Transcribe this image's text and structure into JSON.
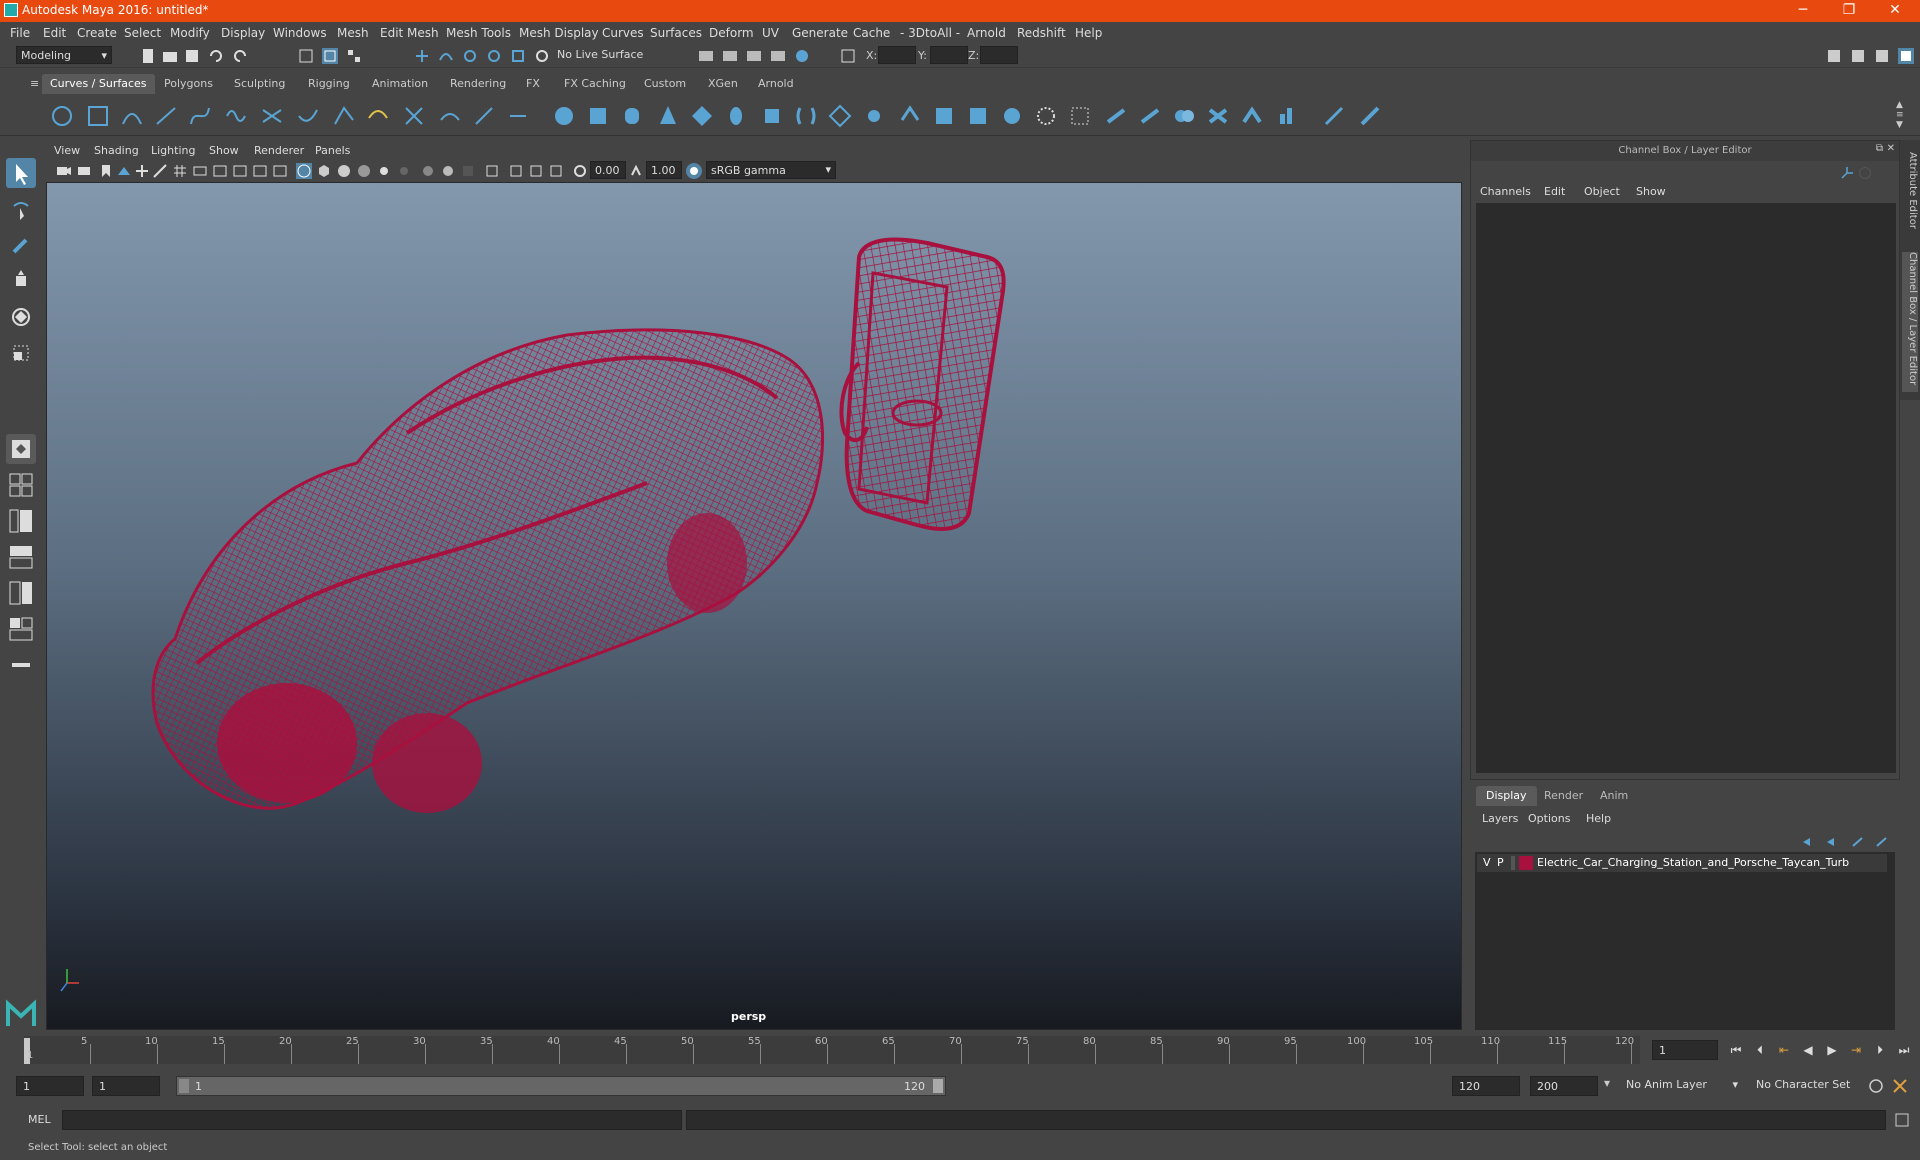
{
  "titlebar": {
    "title": "Autodesk Maya 2016: untitled*",
    "minimize": "─",
    "restore": "❐",
    "close": "✕"
  },
  "menubar": [
    "File",
    "Edit",
    "Create",
    "Select",
    "Modify",
    "Display",
    "Windows",
    "Mesh",
    "Edit Mesh",
    "Mesh Tools",
    "Mesh Display",
    "Curves",
    "Surfaces",
    "Deform",
    "UV",
    "Generate",
    "Cache",
    "- 3DtoAll -",
    "Arnold",
    "Redshift",
    "Help"
  ],
  "statusline": {
    "mode": "Modeling",
    "live_surface": "No Live Surface",
    "x_label": "X:",
    "y_label": "Y:",
    "z_label": "Z:"
  },
  "shelf_tabs": [
    "Curves / Surfaces",
    "Polygons",
    "Sculpting",
    "Rigging",
    "Animation",
    "Rendering",
    "FX",
    "FX Caching",
    "Custom",
    "XGen",
    "Arnold"
  ],
  "shelf_active": "Curves / Surfaces",
  "viewport": {
    "menu": [
      "View",
      "Shading",
      "Lighting",
      "Show",
      "Renderer",
      "Panels"
    ],
    "exposure": "0.00",
    "gamma": "1.00",
    "color_space": "sRGB gamma",
    "camera": "persp",
    "wire_color": "#a8103e"
  },
  "channel_box": {
    "header": "Channel Box / Layer Editor",
    "menu": [
      "Channels",
      "Edit",
      "Object",
      "Show"
    ]
  },
  "layer_editor": {
    "tabs": [
      "Display",
      "Render",
      "Anim"
    ],
    "active_tab": "Display",
    "menu": [
      "Layers",
      "Options",
      "Help"
    ],
    "layers": [
      {
        "v": "V",
        "p": "P",
        "color": "#a8103e",
        "name": "Electric_Car_Charging_Station_and_Porsche_Taycan_Turb"
      }
    ]
  },
  "side_tabs": [
    "Attribute Editor",
    "Channel Box / Layer Editor"
  ],
  "timeslider": {
    "labels": [
      "1",
      "5",
      "10",
      "15",
      "20",
      "25",
      "30",
      "35",
      "40",
      "45",
      "50",
      "55",
      "60",
      "65",
      "70",
      "75",
      "80",
      "85",
      "90",
      "95",
      "100",
      "105",
      "110",
      "115",
      "120"
    ],
    "current_frame": "1"
  },
  "range": {
    "start": "1",
    "playback_start": "1",
    "range_start_label": "1",
    "range_end_label": "120",
    "playback_end": "120",
    "end": "200",
    "anim_layer": "No Anim Layer",
    "character_set": "No Character Set"
  },
  "cmdline": {
    "label": "MEL"
  },
  "helpline": {
    "text": "Select Tool: select an object"
  }
}
